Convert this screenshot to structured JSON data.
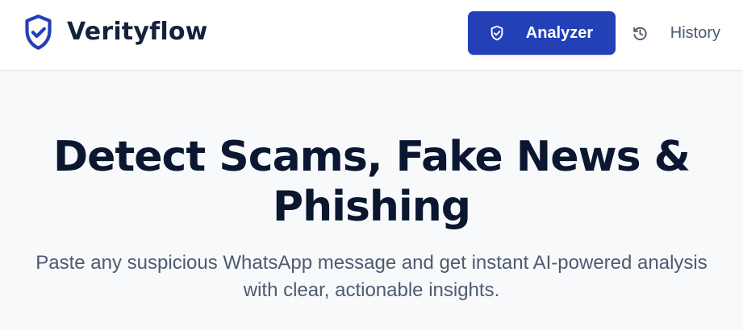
{
  "app": {
    "name": "Verityflow",
    "logo_icon": "shield-check-icon",
    "colors": {
      "accent": "#2340B7",
      "heading": "#0B1730",
      "body_text": "#4C5B6F",
      "background": "#F8F9FB",
      "header_background": "#FFFFFF"
    }
  },
  "navigation": {
    "items": [
      {
        "label": "Analyzer",
        "icon": "shield-check-icon",
        "active": true
      },
      {
        "label": "History",
        "icon": "history-icon",
        "active": false
      }
    ]
  },
  "hero": {
    "title_line_1": "Detect Scams, Fake News &",
    "title_line_2": "Phishing",
    "subtitle_line_1": "Paste any suspicious WhatsApp message and get instant AI-powered analysis",
    "subtitle_line_2": "with clear, actionable insights."
  }
}
